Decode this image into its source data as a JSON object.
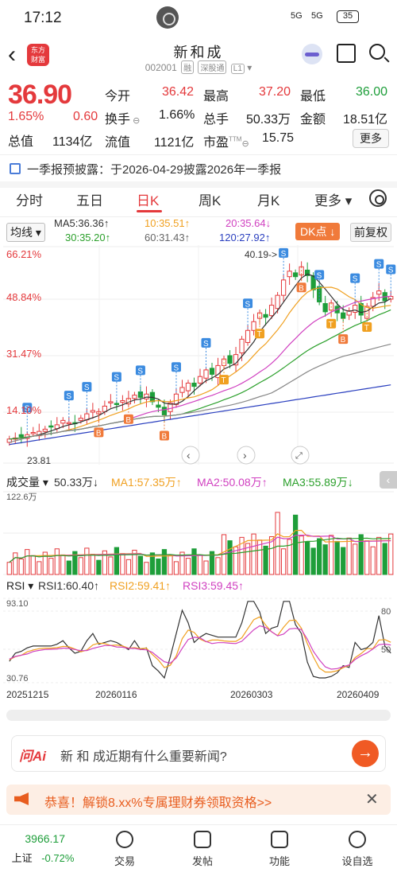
{
  "status": {
    "time": "17:12",
    "sig1": "5G",
    "sig2": "5G",
    "battery": "35"
  },
  "header": {
    "logo": "东方\n财富",
    "title": "新和成",
    "code": "002001",
    "tag1": "融",
    "tag2": "深股通",
    "tag3": "L1"
  },
  "quote": {
    "price": "36.90",
    "pct": "1.65%",
    "chg": "0.60",
    "total_cap_label": "总值",
    "total_cap": "1134亿",
    "rows": [
      [
        {
          "l": "今开",
          "v": "36.42",
          "c": "red"
        },
        {
          "l": "最高",
          "v": "37.20",
          "c": "red"
        },
        {
          "l": "最低",
          "v": "36.00",
          "c": "green"
        }
      ],
      [
        {
          "l": "换手",
          "v": "1.66%",
          "c": "dark"
        },
        {
          "l": "总手",
          "v": "50.33万",
          "c": "dark"
        },
        {
          "l": "金额",
          "v": "18.51亿",
          "c": "dark"
        }
      ],
      [
        {
          "l": "流值",
          "v": "1121亿",
          "c": "dark"
        },
        {
          "l": "市盈",
          "v": "15.75",
          "c": "dark"
        }
      ]
    ],
    "more": "更多"
  },
  "notice": "一季报预披露：于2026-04-29披露2026年一季报",
  "tabs": [
    "分时",
    "五日",
    "日K",
    "周K",
    "月K",
    "更多"
  ],
  "ma": {
    "chip": "均线",
    "ma5": "MA5:36.36↑",
    "ma10": "10:35.51↑",
    "ma20": "20:35.64↓",
    "ma30": "30:35.20↑",
    "ma60": "60:31.43↑",
    "ma120": "120:27.92↑",
    "dk": "DK点",
    "fq": "前复权"
  },
  "colors": {
    "ma5": "#333333",
    "ma10": "#f0a020",
    "ma20": "#d040c0",
    "ma30": "#2ca02c",
    "ma60": "#888888",
    "ma120": "#2a3fbf",
    "up": "#e4393c",
    "down": "#1e9e3a"
  },
  "chart_data": [
    {
      "type": "candlestick",
      "yaxis_labels": [
        "66.21%",
        "48.84%",
        "31.47%",
        "14.10%"
      ],
      "annotations": [
        "40.19->",
        "23.81"
      ],
      "closes": [
        23.9,
        24.0,
        24.1,
        24.3,
        24.5,
        24.6,
        24.8,
        25.0,
        25.2,
        25.6,
        25.4,
        25.3,
        25.8,
        26.2,
        26.5,
        26.4,
        26.9,
        27.3,
        27.1,
        27.4,
        27.6,
        27.9,
        27.7,
        28.0,
        27.3,
        26.8,
        26.1,
        27.2,
        28.0,
        28.6,
        29.0,
        28.7,
        29.6,
        30.2,
        29.8,
        30.6,
        31.2,
        30.8,
        31.6,
        33.0,
        33.8,
        34.6,
        35.4,
        35.0,
        36.1,
        37.0,
        38.4,
        39.2,
        38.7,
        39.6,
        38.8,
        37.5,
        36.4,
        35.5,
        36.3,
        35.4,
        34.9,
        35.6,
        36.1,
        35.2,
        36.0,
        36.8,
        37.4,
        36.5,
        36.9
      ]
    },
    {
      "type": "bar",
      "title": "成交量",
      "labels": [
        "50.33万↓",
        "MA1:57.35万↑",
        "MA2:50.08万↑",
        "MA3:55.89万↓"
      ],
      "ymax_label": "122.6万"
    },
    {
      "type": "line",
      "title": "RSI",
      "labels": [
        "RSI1:60.40↑",
        "RSI2:59.41↑",
        "RSI3:59.45↑"
      ],
      "ymax_label": "93.10",
      "ymin_label": "30.76",
      "right_labels": [
        "80",
        "50"
      ],
      "x_labels": [
        "20251215",
        "20260116",
        "20260303",
        "20260409"
      ]
    }
  ],
  "ai": {
    "logo": "问Ai",
    "text": "新 和 成近期有什么重要新闻?"
  },
  "promo": "恭喜！解锁8.xx%专属理财券领取资格>>",
  "nav": {
    "index_value": "3966.17",
    "index_name": "上证",
    "index_pct": "-0.72%",
    "items": [
      "交易",
      "发帖",
      "功能",
      "设自选"
    ]
  }
}
